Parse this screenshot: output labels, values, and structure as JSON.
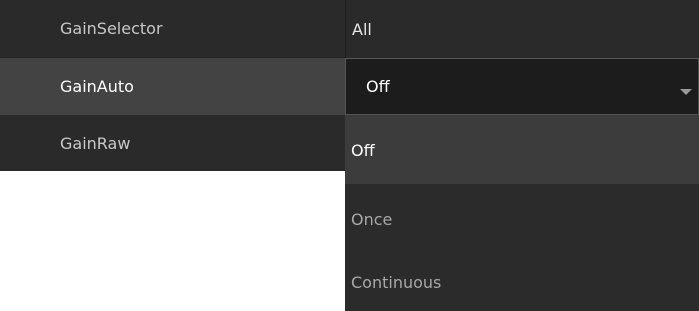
{
  "properties": [
    {
      "name": "GainSelector",
      "value": "All"
    },
    {
      "name": "GainAuto",
      "value": "Off"
    },
    {
      "name": "GainRaw",
      "value": ""
    }
  ],
  "dropdown": {
    "options": [
      "Off",
      "Once",
      "Continuous"
    ],
    "selected": "Off"
  },
  "colors": {
    "row_background": "#2a2a2a",
    "selected_row_background": "#434343",
    "editor_background": "#1c1c1c",
    "dropdown_background": "#2b2b2b",
    "dropdown_highlight": "#3c3c3c"
  },
  "icons": {
    "dropdown_arrow": "chevron-down-icon"
  }
}
